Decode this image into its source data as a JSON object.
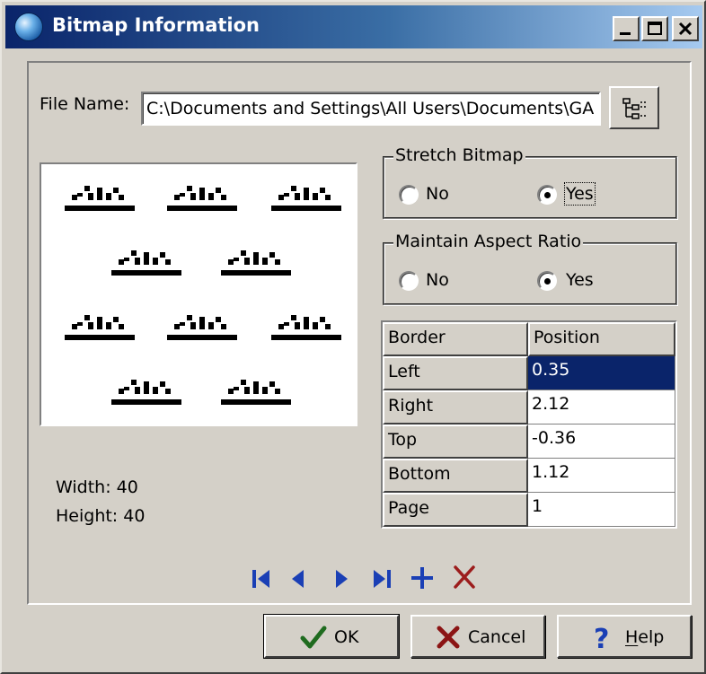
{
  "window": {
    "title": "Bitmap Information",
    "minimize_label": "_",
    "maximize_label": "□",
    "close_label": "✕"
  },
  "file": {
    "label": "File Name:",
    "value": "C:\\Documents and Settings\\All Users\\Documents\\GA"
  },
  "stretch_bitmap": {
    "title": "Stretch Bitmap",
    "options": [
      "No",
      "Yes"
    ],
    "selected": "Yes"
  },
  "maintain_aspect_ratio": {
    "title": "Maintain Aspect Ratio",
    "options": [
      "No",
      "Yes"
    ],
    "selected": "Yes"
  },
  "border_table": {
    "headers": [
      "Border",
      "Position"
    ],
    "rows": [
      {
        "border": "Left",
        "position": "0.35",
        "selected": true
      },
      {
        "border": "Right",
        "position": "2.12",
        "selected": false
      },
      {
        "border": "Top",
        "position": "-0.36",
        "selected": false
      },
      {
        "border": "Bottom",
        "position": "1.12",
        "selected": false
      },
      {
        "border": "Page",
        "position": "1",
        "selected": false
      }
    ]
  },
  "image_info": {
    "width_label": "Width: 40",
    "height_label": "Height: 40"
  },
  "navigator": {
    "icons": [
      "first-record-icon",
      "previous-record-icon",
      "next-record-icon",
      "last-record-icon",
      "add-record-icon",
      "delete-record-icon"
    ],
    "accent": "#1a3fb5",
    "delete_color": "#9c1c1c"
  },
  "buttons": {
    "ok": "OK",
    "cancel": "Cancel",
    "help": "Help"
  },
  "colors": {
    "face": "#d4d0c8",
    "title_start": "#0a246a",
    "title_end": "#a6caf0",
    "selection": "#0a246a"
  }
}
